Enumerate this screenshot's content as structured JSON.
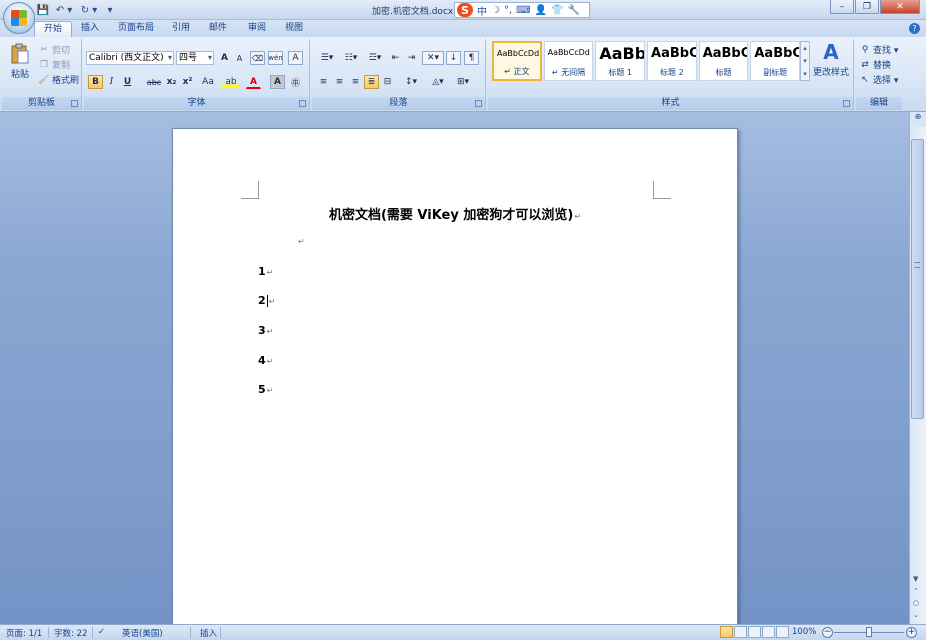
{
  "titlebar": {
    "title": "加密.机密文档.docx (只",
    "ime": {
      "logo": "S",
      "chars": [
        "中",
        "☽",
        "°,",
        "⌨",
        "👤",
        "👕",
        "🔧"
      ]
    },
    "qat": [
      "💾",
      "↶ ▾",
      "↻ ▾",
      "▾"
    ],
    "window": {
      "minimize": "–",
      "restore": "❐",
      "close": "✕"
    }
  },
  "tabs": [
    "开始",
    "插入",
    "页面布局",
    "引用",
    "邮件",
    "审阅",
    "视图"
  ],
  "ribbon": {
    "clipboard": {
      "label": "剪贴板",
      "paste": "粘贴",
      "cut": "剪切",
      "copy": "复制",
      "format_painter": "格式刷"
    },
    "font": {
      "label": "字体",
      "font_name": "Calibri (西文正文)",
      "font_size": "四号",
      "grow": "A",
      "shrink": "A",
      "bold": "B",
      "italic": "I",
      "underline": "U",
      "strike": "abc",
      "subscript": "x₂",
      "superscript": "x²",
      "change_case": "Aa",
      "highlight": "ab",
      "font_color": "A",
      "char_shading": "A",
      "enclose": "㊥",
      "phonetic": "wén",
      "char_border": "A"
    },
    "paragraph": {
      "label": "段落"
    },
    "styles": {
      "label": "样式",
      "items": [
        {
          "sample": "AaBbCcDd",
          "name": "↵ 正文"
        },
        {
          "sample": "AaBbCcDd",
          "name": "↵ 无间隔"
        },
        {
          "sample": "AaBb",
          "name": "标题 1"
        },
        {
          "sample": "AaBbC",
          "name": "标题 2"
        },
        {
          "sample": "AaBbC",
          "name": "标题"
        },
        {
          "sample": "AaBbC",
          "name": "副标题"
        }
      ],
      "change_styles": "更改样式"
    },
    "editing": {
      "label": "编辑",
      "find": "查找 ▾",
      "replace": "替换",
      "select": "选择 ▾"
    }
  },
  "document": {
    "title": "机密文档(需要 ViKey 加密狗才可以浏览)",
    "para_mark": "↵",
    "list": [
      "1",
      "2",
      "3",
      "4",
      "5"
    ]
  },
  "statusbar": {
    "page": "页面: 1/1",
    "words": "字数: 22",
    "language": "英语(美国)",
    "mode": "插入",
    "zoom": "100%"
  },
  "colors": {
    "ribbon_text": "#15428b",
    "workspace": "#7f9dcc",
    "selected_style_border": "#f0b63a"
  }
}
